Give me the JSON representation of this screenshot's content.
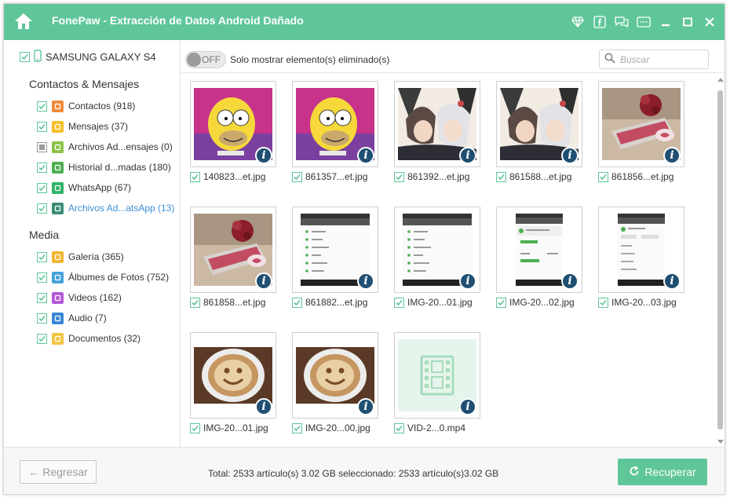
{
  "window": {
    "title": "FonePaw - Extracción de Datos Android Dañado"
  },
  "sidebar": {
    "device": "SAMSUNG GALAXY S4",
    "sections": [
      {
        "title": "Contactos & Mensajes",
        "items": [
          {
            "label": "Contactos (918)",
            "icon": "contacts-icon",
            "color": "#f08a3a",
            "state": "checked"
          },
          {
            "label": "Mensajes (37)",
            "icon": "messages-icon",
            "color": "#f5c02a",
            "state": "checked"
          },
          {
            "label": "Archivos Ad...ensajes (0)",
            "icon": "attachment-icon",
            "color": "#8bc34a",
            "state": "partial"
          },
          {
            "label": "Historial d...madas (180)",
            "icon": "call-log-icon",
            "color": "#4caf50",
            "state": "checked"
          },
          {
            "label": "WhatsApp (67)",
            "icon": "whatsapp-icon",
            "color": "#2fb36a",
            "state": "checked"
          },
          {
            "label": "Archivos Ad...atsApp (13)",
            "icon": "whatsapp-attachment-icon",
            "color": "#3d8c78",
            "state": "checked",
            "active": true
          }
        ]
      },
      {
        "title": "Media",
        "items": [
          {
            "label": "Galería (365)",
            "icon": "gallery-icon",
            "color": "#f2b531",
            "state": "checked"
          },
          {
            "label": "Álbumes de Fotos (752)",
            "icon": "photo-album-icon",
            "color": "#46a2d9",
            "state": "checked"
          },
          {
            "label": "Videos (162)",
            "icon": "video-icon",
            "color": "#b45ad9",
            "state": "checked"
          },
          {
            "label": "Audio (7)",
            "icon": "audio-icon",
            "color": "#3a86d6",
            "state": "checked"
          },
          {
            "label": "Documentos (32)",
            "icon": "folder-icon",
            "color": "#f3c544",
            "state": "checked"
          }
        ]
      }
    ]
  },
  "toolbar": {
    "toggle_label": "OFF",
    "toggle_text": "Solo mostrar elemento(s) eliminado(s)",
    "search_placeholder": "Buscar"
  },
  "files": [
    {
      "name": "140823...et.jpg",
      "type": "cartoon"
    },
    {
      "name": "861357...et.jpg",
      "type": "cartoon"
    },
    {
      "name": "861392...et.jpg",
      "type": "anime"
    },
    {
      "name": "861588...et.jpg",
      "type": "anime"
    },
    {
      "name": "861856...et.jpg",
      "type": "photo-cake"
    },
    {
      "name": "861858...et.jpg",
      "type": "photo-cake"
    },
    {
      "name": "861882...et.jpg",
      "type": "screenshot"
    },
    {
      "name": "IMG-20...01.jpg",
      "type": "screenshot"
    },
    {
      "name": "IMG-20...02.jpg",
      "type": "screenshot-dialog"
    },
    {
      "name": "IMG-20...03.jpg",
      "type": "screenshot-settings"
    },
    {
      "name": "IMG-20...01.jpg",
      "type": "coffee"
    },
    {
      "name": "IMG-20...00.jpg",
      "type": "coffee"
    },
    {
      "name": "VID-2...0.mp4",
      "type": "video"
    }
  ],
  "footer": {
    "back_label": "Regresar",
    "total_text": "Total: 2533 artículo(s) 3.02 GB seleccionado: 2533 artículo(s)3.02 GB",
    "recover_label": "Recuperar"
  },
  "colors": {
    "accent": "#5fc69a",
    "active_link": "#3b8fd6",
    "info_badge": "#1f4f72"
  }
}
